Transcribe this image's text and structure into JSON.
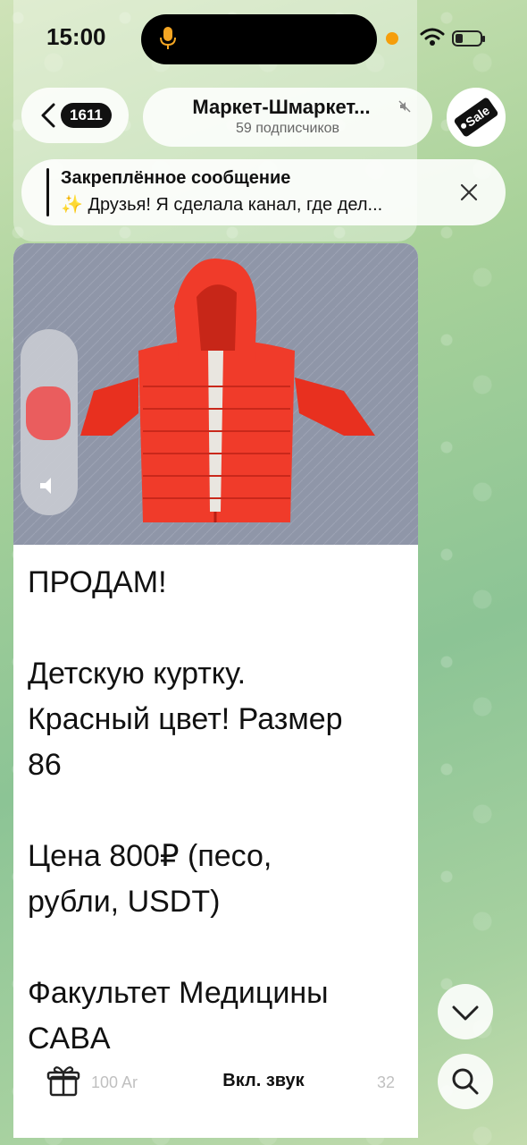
{
  "status_bar": {
    "time": "15:00"
  },
  "header": {
    "back_badge": "1611",
    "channel_title": "Маркет-Шмаркет...",
    "subscribers": "59 подписчиков",
    "avatar_text": "Sale"
  },
  "pinned": {
    "title": "Закреплённое сообщение",
    "text": "✨ Друзья! Я сделала канал, где дел..."
  },
  "message": {
    "lines": [
      "ПРОДАМ!",
      "",
      "Детскую куртку.",
      "Красный цвет! Размер",
      "86",
      "",
      "Цена 800₽ (песо,",
      "рубли, USDT)",
      "",
      "Факультет Медицины",
      "CABA"
    ]
  },
  "bottom": {
    "sound_button": "Вкл. звук",
    "ghost_left": "100 Ar",
    "ghost_right": "32"
  },
  "colors": {
    "accent_red": "#f03b2a",
    "photo_bg": "#8f96a8"
  }
}
